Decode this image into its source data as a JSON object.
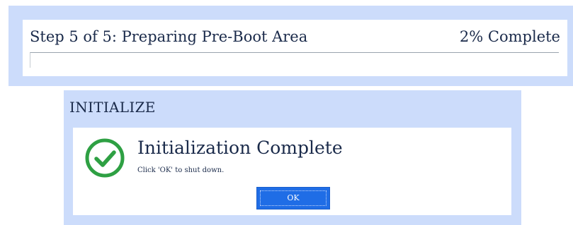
{
  "progress": {
    "step_text": "Step 5 of 5: Preparing Pre-Boot Area",
    "percent_text": "2% Complete",
    "fraction": 0.0
  },
  "dialog": {
    "title": "INITIALIZE",
    "headline": "Initialization Complete",
    "message": "Click 'OK' to shut down.",
    "icon": "check-circle-icon",
    "ok_label": "OK"
  },
  "colors": {
    "panel_bg": "#ccdcfb",
    "accent": "#1f6de6",
    "success": "#2ea043",
    "text": "#1a2a4a"
  }
}
